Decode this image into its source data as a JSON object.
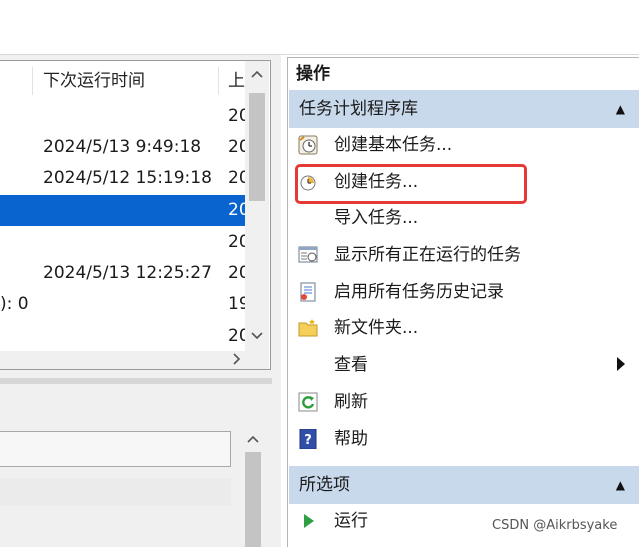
{
  "task_list": {
    "columns": [
      {
        "label": ""
      },
      {
        "label": "下次运行时间"
      },
      {
        "label": "上"
      }
    ],
    "rows": [
      {
        "c0": "",
        "next_run": "",
        "last": "20",
        "selected": false
      },
      {
        "c0": "",
        "next_run": "2024/5/13 9:49:18",
        "last": "20",
        "selected": false
      },
      {
        "c0": "",
        "next_run": "2024/5/12 15:19:18",
        "last": "20",
        "selected": false
      },
      {
        "c0": "",
        "next_run": "",
        "last": "20",
        "selected": true
      },
      {
        "c0": "",
        "next_run": "",
        "last": "20",
        "selected": false
      },
      {
        "c0": "",
        "next_run": "2024/5/13 12:25:27",
        "last": "20",
        "selected": false
      },
      {
        "c0": "): 0",
        "next_run": "",
        "last": "19",
        "selected": false
      },
      {
        "c0": "",
        "next_run": "",
        "last": "20",
        "selected": false
      }
    ],
    "scroll_up_icon": "chevron-up-icon",
    "scroll_down_icon": "chevron-down-icon",
    "scroll_right_icon": "chevron-right-icon"
  },
  "actions": {
    "title": "操作",
    "library_group": {
      "label": "任务计划程序库",
      "collapse_icon": "triangle-up-icon",
      "items": [
        {
          "label": "创建基本任务...",
          "icon": "basic-task-wizard-icon"
        },
        {
          "label": "创建任务...",
          "icon": "create-task-icon"
        },
        {
          "label": "导入任务...",
          "icon": ""
        },
        {
          "label": "显示所有正在运行的任务",
          "icon": "running-tasks-icon"
        },
        {
          "label": "启用所有任务历史记录",
          "icon": "history-log-icon"
        },
        {
          "label": "新文件夹...",
          "icon": "folder-icon"
        },
        {
          "label": "查看",
          "icon": "",
          "submenu": true
        },
        {
          "label": "刷新",
          "icon": "refresh-icon"
        },
        {
          "label": "帮助",
          "icon": "help-icon"
        }
      ]
    },
    "selected_group": {
      "label": "所选项",
      "collapse_icon": "triangle-up-icon",
      "items": [
        {
          "label": "运行",
          "icon": "run-icon"
        }
      ]
    }
  },
  "watermark": "CSDN @Aikrbsyake",
  "colors": {
    "selection": "#0a64cf",
    "group_header": "#c9d9ec",
    "highlight_border": "#e53935"
  }
}
